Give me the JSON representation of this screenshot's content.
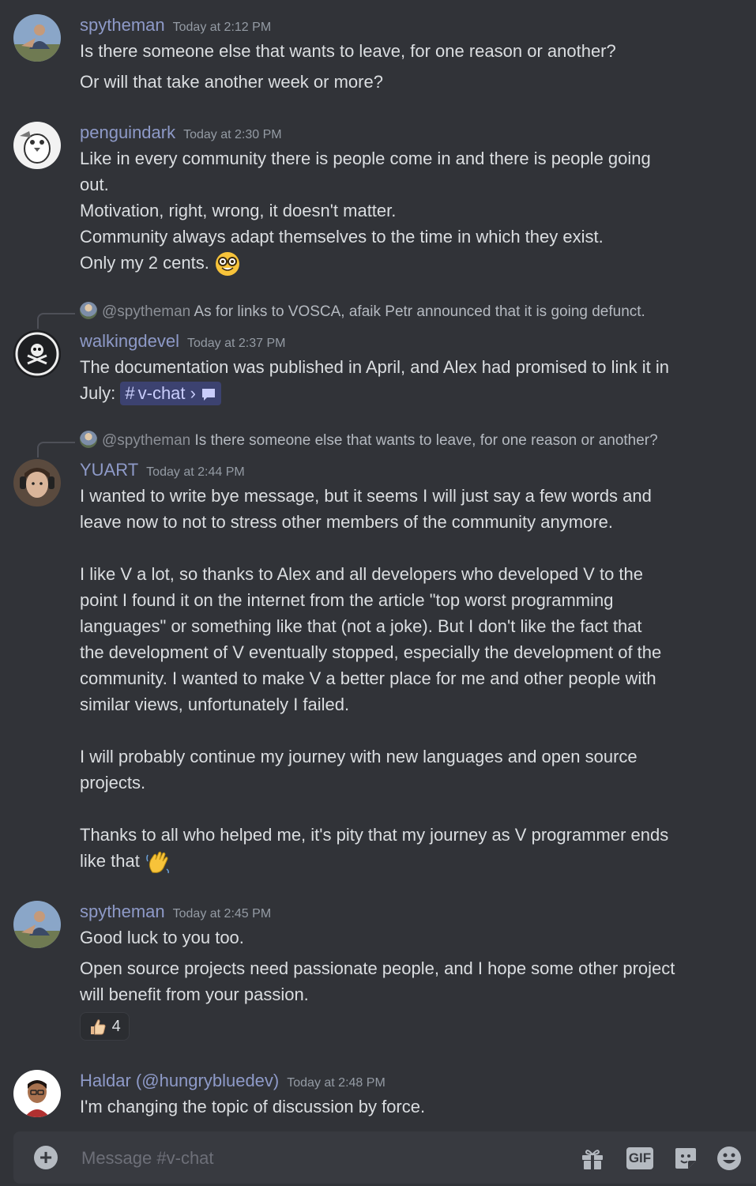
{
  "messages": [
    {
      "author": "spytheman",
      "timestamp": "Today at 2:12 PM",
      "lines": [
        "Is there someone else that wants to leave, for one reason or another?",
        "Or will that take another week or more?"
      ]
    },
    {
      "author": "penguindark",
      "timestamp": "Today at 2:30 PM",
      "lines": [
        "Like in every community there is people come in and there is people going",
        "out.",
        "Motivation, right, wrong, it doesn't matter.",
        "Community always adapt themselves to the time in which they exist.",
        "Only my 2 cents."
      ]
    },
    {
      "reply_to": "@spytheman",
      "reply_text": "As for links to VOSCA, afaik Petr announced that it is going defunct.",
      "author": "walkingdevel",
      "timestamp": "Today at 2:37 PM",
      "lines": [
        "The documentation was published in April, and Alex had promised to link it in",
        "July:"
      ],
      "channel_mention": "v-chat"
    },
    {
      "reply_to": "@spytheman",
      "reply_text": "Is there someone else that wants to leave, for one reason or another?",
      "author": "YUART",
      "timestamp": "Today at 2:44 PM",
      "lines": [
        "I wanted to write bye message, but it seems I will just say a few words and",
        "leave now to not to stress other members of the community anymore.",
        "",
        "I like V a lot, so thanks to Alex and all developers who developed V to the",
        "point I found it on the internet from the article \"top worst programming",
        "languages\" or something like that (not a joke). But I don't like the fact that",
        "the development of V eventually stopped, especially the development of the",
        "community. I wanted to make V a better place for me and other people with",
        "similar views, unfortunately I failed.",
        "",
        "I will probably continue my journey with new languages and open source",
        "projects.",
        "",
        "Thanks to all who helped me, it's pity that my journey as V programmer ends",
        "like that"
      ]
    },
    {
      "author": "spytheman",
      "timestamp": "Today at 2:45 PM",
      "lines": [
        "Good luck to you too.",
        "Open source projects need passionate people, and I hope some other project",
        "will benefit from your passion."
      ],
      "reaction_count": "4"
    },
    {
      "author": "Haldar (@hungrybluedev)",
      "timestamp": "Today at 2:48 PM",
      "lines": [
        "I'm changing the topic of discussion by force."
      ]
    }
  ],
  "composer": {
    "placeholder": "Message #v-chat",
    "gif_label": "GIF",
    "icons": [
      "plus-circle-icon",
      "gift-icon",
      "gif-icon",
      "sticker-icon",
      "emoji-smile-icon"
    ]
  },
  "colors": {
    "background": "#313338",
    "username": "#8e9ac8",
    "text": "#dbdee1",
    "timestamp": "#949ba4",
    "mention_bg": "#3c4270"
  }
}
